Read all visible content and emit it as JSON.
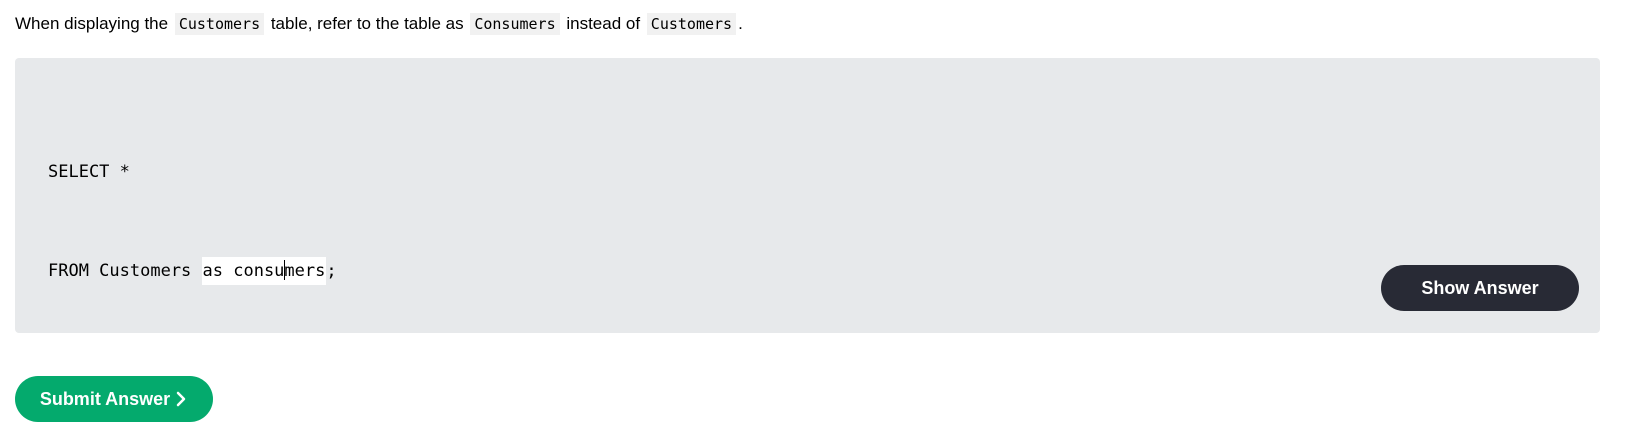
{
  "instruction": {
    "prefix": "When displaying the ",
    "code1": "Customers",
    "middle1": " table, refer to the table as ",
    "code2": "Consumers",
    "middle2": " instead of ",
    "code3": "Customers",
    "suffix": "."
  },
  "editor": {
    "line1": "SELECT *",
    "line2_before": "FROM Customers ",
    "line2_selected_before_caret": "as consu",
    "line2_selected_after_caret": "mers",
    "line2_after": ";"
  },
  "buttons": {
    "show_answer_label": "Show Answer",
    "submit_label": "Submit Answer"
  },
  "colors": {
    "panel_bg": "#e7e9eb",
    "show_answer_bg": "#282a35",
    "submit_bg": "#04aa6d"
  },
  "icons": {
    "submit_chevron": "chevron-right-icon"
  }
}
